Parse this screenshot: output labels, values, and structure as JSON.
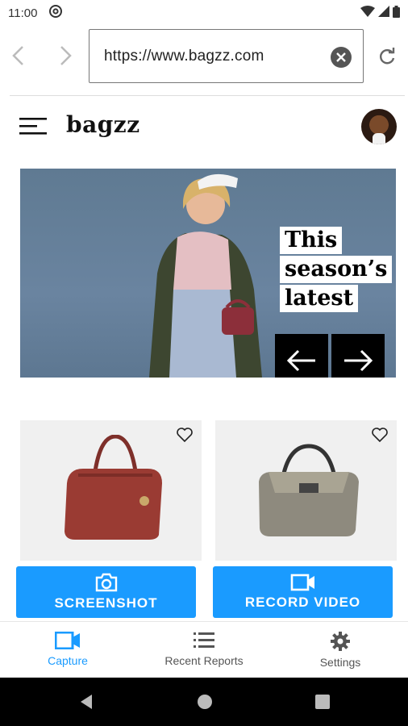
{
  "status_bar": {
    "time": "11:00"
  },
  "browser": {
    "url": "https://www.bagzz.com"
  },
  "site": {
    "logo": "bagzz"
  },
  "hero": {
    "caption_lines": [
      "This",
      "season’s",
      "latest"
    ]
  },
  "actions": {
    "screenshot_label": "SCREENSHOT",
    "record_label": "RECORD VIDEO"
  },
  "bottom_nav": {
    "items": [
      {
        "label": "Capture",
        "icon": "video-camera-icon",
        "active": true
      },
      {
        "label": "Recent Reports",
        "icon": "list-icon",
        "active": false
      },
      {
        "label": "Settings",
        "icon": "gear-icon",
        "active": false
      }
    ]
  },
  "colors": {
    "accent": "#1a9bff",
    "nav_active": "#1a9bff",
    "nav_inactive": "#555555",
    "hero_bg": "#6a84a0"
  }
}
